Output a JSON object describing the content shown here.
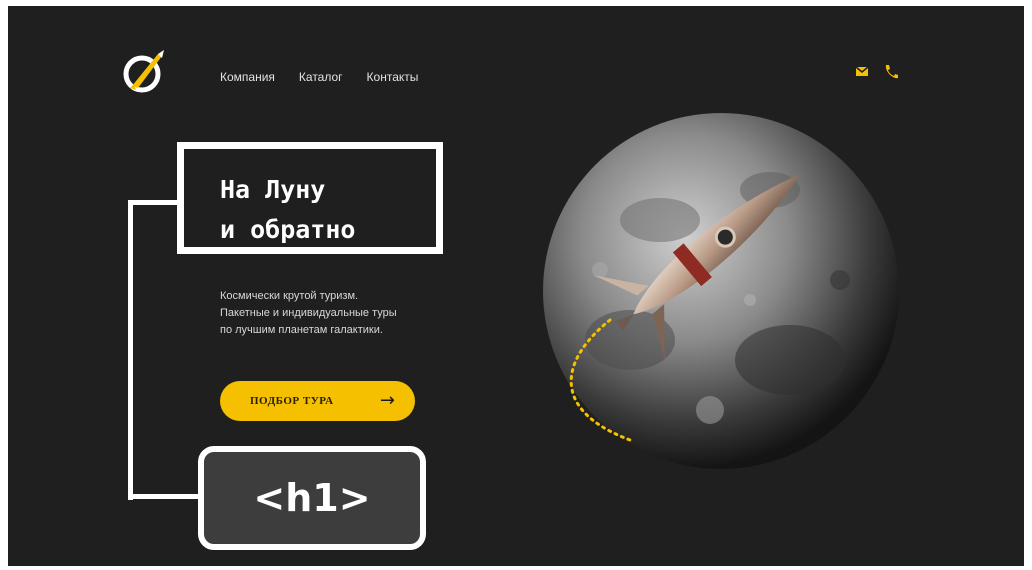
{
  "header": {
    "nav": [
      "Компания",
      "Каталог",
      "Контакты"
    ],
    "icons": [
      "mail-icon",
      "phone-icon"
    ],
    "accent_color": "#f5c000"
  },
  "hero": {
    "title": "На Луну\nи обратно",
    "subtitle": "Космически крутой туризм.\nПакетные и индивидуальные туры\nпо лучшим планетам галактики.",
    "cta_label": "ПОДБОР ТУРА",
    "cta_arrow": "→"
  },
  "annotation": {
    "tag": "<h1>"
  }
}
